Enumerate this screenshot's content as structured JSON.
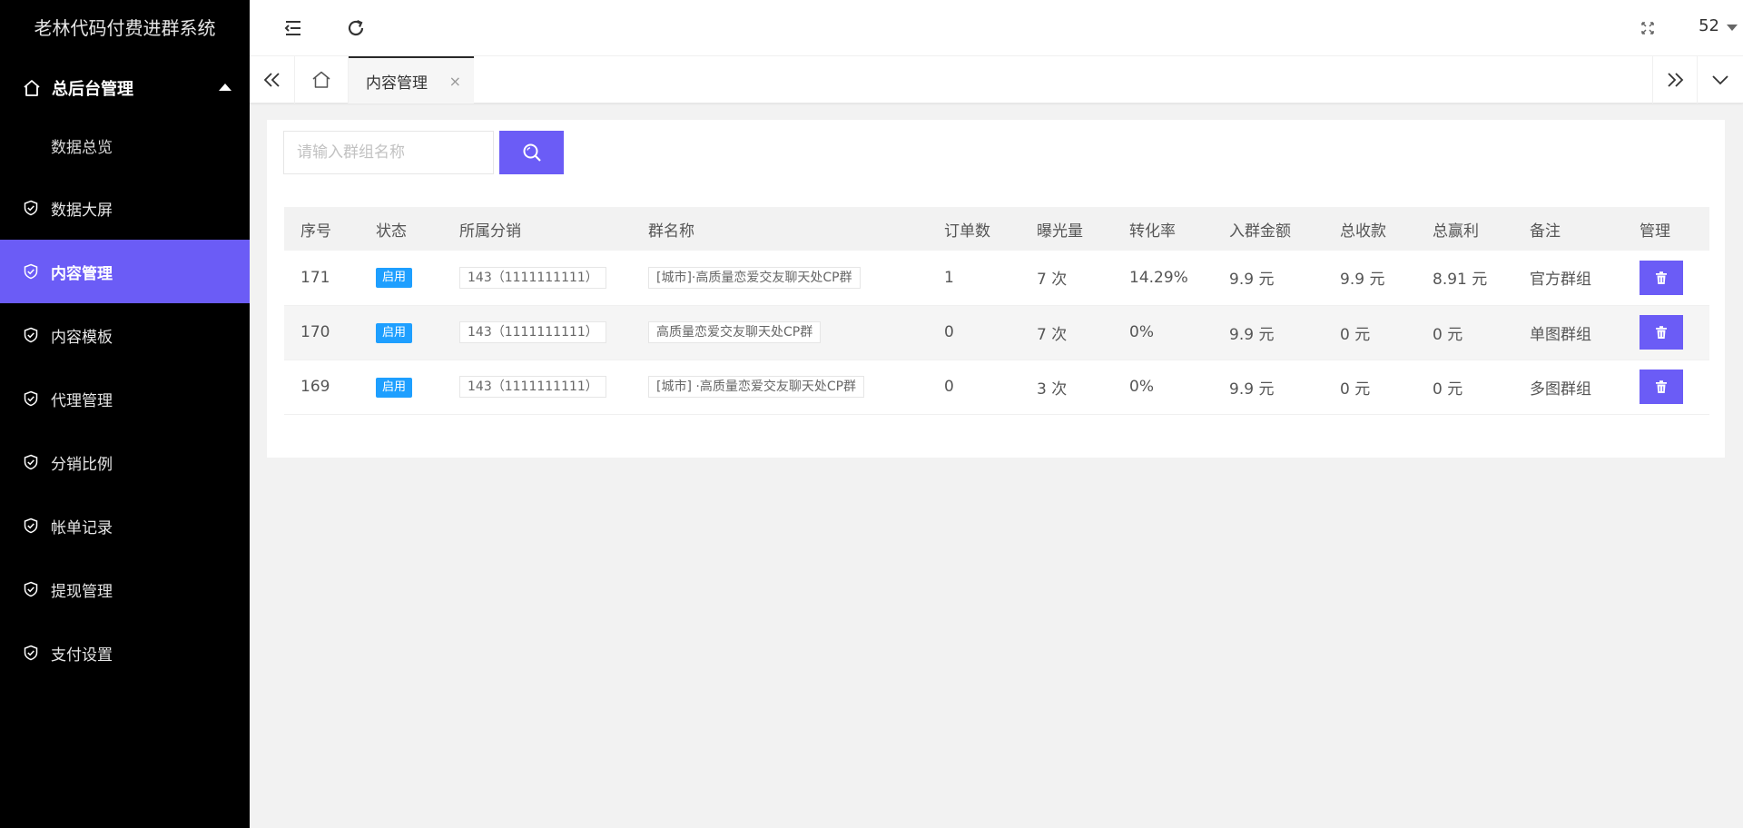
{
  "app": {
    "title": "老林代码付费进群系统"
  },
  "sidebar": {
    "group": {
      "label": "总后台管理",
      "icon": "home-icon",
      "expanded": true
    },
    "sub_items": [
      {
        "label": "数据总览"
      }
    ],
    "items": [
      {
        "label": "数据大屏",
        "icon": "shield-check-icon",
        "active": false
      },
      {
        "label": "内容管理",
        "icon": "shield-check-icon",
        "active": true
      },
      {
        "label": "内容模板",
        "icon": "shield-check-icon",
        "active": false
      },
      {
        "label": "代理管理",
        "icon": "shield-check-icon",
        "active": false
      },
      {
        "label": "分销比例",
        "icon": "shield-check-icon",
        "active": false
      },
      {
        "label": "帐单记录",
        "icon": "shield-check-icon",
        "active": false
      },
      {
        "label": "提现管理",
        "icon": "shield-check-icon",
        "active": false
      },
      {
        "label": "支付设置",
        "icon": "shield-check-icon",
        "active": false
      }
    ]
  },
  "header": {
    "icons": [
      "menu-collapse-icon",
      "refresh-icon",
      "fullscreen-icon"
    ],
    "user": "52"
  },
  "tabs": {
    "icons": [
      "tabs-prev-icon",
      "home-tab-icon",
      "tabs-next-icon",
      "tabs-menu-icon"
    ],
    "active": {
      "label": "内容管理",
      "close": "×"
    }
  },
  "search": {
    "placeholder": "请输入群组名称",
    "icon": "search-icon"
  },
  "table": {
    "columns": [
      "序号",
      "状态",
      "所属分销",
      "群名称",
      "订单数",
      "曝光量",
      "转化率",
      "入群金额",
      "总收款",
      "总赢利",
      "备注",
      "管理"
    ],
    "rows": [
      {
        "id": "171",
        "status": "启用",
        "distributor": "143（1111111111）",
        "group_name": "[城市]·高质量恋爱交友聊天处CP群",
        "orders": "1",
        "exposure": "7 次",
        "conversion": "14.29%",
        "amount": "9.9 元",
        "income": "9.9 元",
        "profit": "8.91 元",
        "remark": "官方群组"
      },
      {
        "id": "170",
        "status": "启用",
        "distributor": "143（1111111111）",
        "group_name": "高质量恋爱交友聊天处CP群",
        "orders": "0",
        "exposure": "7 次",
        "conversion": "0%",
        "amount": "9.9 元",
        "income": "0 元",
        "profit": "0 元",
        "remark": "单图群组"
      },
      {
        "id": "169",
        "status": "启用",
        "distributor": "143（1111111111）",
        "group_name": "[城市] ·高质量恋爱交友聊天处CP群",
        "orders": "0",
        "exposure": "3 次",
        "conversion": "0%",
        "amount": "9.9 元",
        "income": "0 元",
        "profit": "0 元",
        "remark": "多图群组"
      }
    ],
    "action_icon": "trash-icon"
  },
  "colors": {
    "accent": "#6b5cf6",
    "sidebar_bg": "#000000",
    "badge": "#1e9fff"
  }
}
